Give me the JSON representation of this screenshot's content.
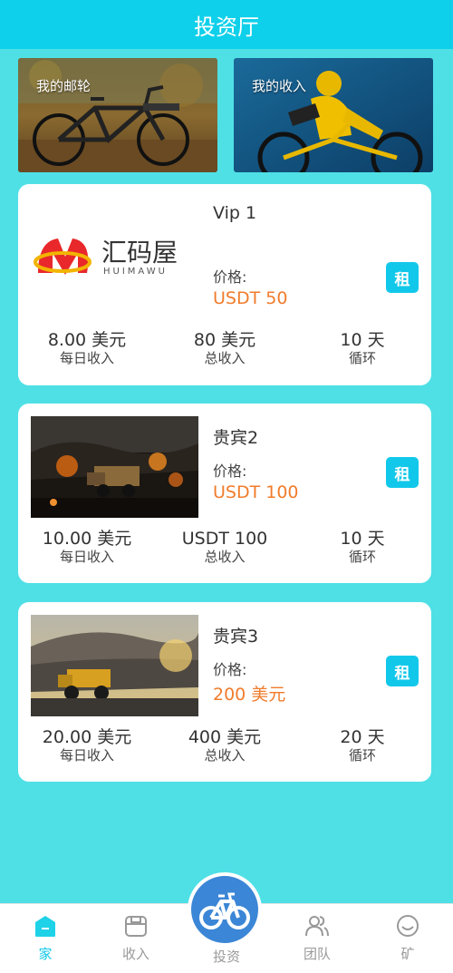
{
  "header": {
    "title": "投资厅"
  },
  "banners": [
    {
      "label": "我的邮轮"
    },
    {
      "label": "我的收入"
    }
  ],
  "products": [
    {
      "logo_text": "汇码屋",
      "logo_sub": "HUIMAWU",
      "name": "Vip 1",
      "price_label": "价格:",
      "price": "USDT 50",
      "rent_label": "租",
      "stats": [
        {
          "value": "8.00 美元",
          "label": "每日收入"
        },
        {
          "value": "80 美元",
          "label": "总收入"
        },
        {
          "value": "10 天",
          "label": "循环"
        }
      ]
    },
    {
      "name": "贵宾2",
      "price_label": "价格:",
      "price": "USDT 100",
      "rent_label": "租",
      "stats": [
        {
          "value": "10.00 美元",
          "label": "每日收入"
        },
        {
          "value": "USDT 100",
          "label": "总收入"
        },
        {
          "value": "10 天",
          "label": "循环"
        }
      ]
    },
    {
      "name": "贵宾3",
      "price_label": "价格:",
      "price": "200 美元",
      "rent_label": "租",
      "stats": [
        {
          "value": "20.00 美元",
          "label": "每日收入"
        },
        {
          "value": "400 美元",
          "label": "总收入"
        },
        {
          "value": "20 天",
          "label": "循环"
        }
      ]
    }
  ],
  "tabbar": {
    "items": [
      {
        "label": "家",
        "icon": "home-icon",
        "active": true
      },
      {
        "label": "收入",
        "icon": "wallet-icon"
      },
      {
        "label": "投资",
        "icon": "bicycle-icon"
      },
      {
        "label": "团队",
        "icon": "team-icon"
      },
      {
        "label": "矿",
        "icon": "smile-icon"
      }
    ]
  },
  "colors": {
    "header": "#0fd0ea",
    "background": "#4fe0e6",
    "accent": "#12c8ea",
    "price": "#f07c2c"
  }
}
